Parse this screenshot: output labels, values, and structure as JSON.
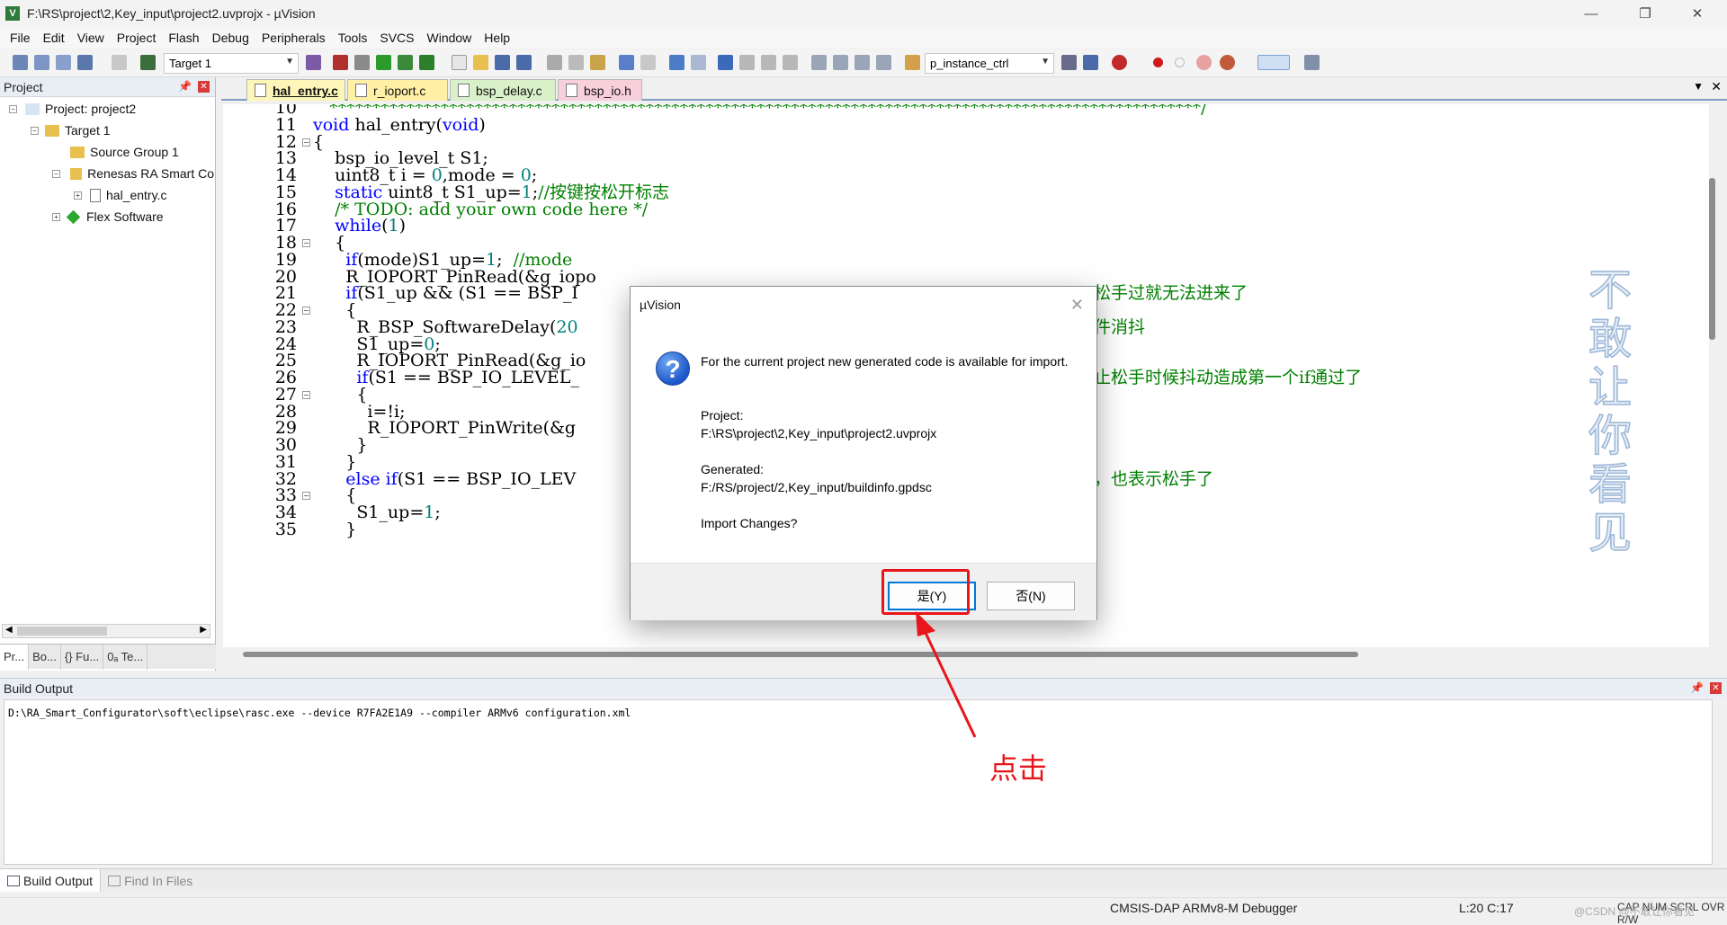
{
  "window": {
    "title": "F:\\RS\\project\\2,Key_input\\project2.uvprojx - µVision",
    "icon": "uvision-icon"
  },
  "menu": [
    "File",
    "Edit",
    "View",
    "Project",
    "Flash",
    "Debug",
    "Peripherals",
    "Tools",
    "SVCS",
    "Window",
    "Help"
  ],
  "toolbar": {
    "target": "Target 1",
    "find_value": "p_instance_ctrl"
  },
  "project_panel": {
    "title": "Project",
    "tree": [
      "Project: project2",
      "Target 1",
      "Source Group 1",
      "Renesas RA Smart Co",
      "hal_entry.c",
      "Flex Software"
    ],
    "tabs": [
      "Pr...",
      "Bo...",
      "{} Fu...",
      "0ₐ Te..."
    ]
  },
  "editor": {
    "tabs": [
      {
        "label": "hal_entry.c",
        "color": "#fdf6b8"
      },
      {
        "label": "r_ioport.c",
        "color": "#fff0a6"
      },
      {
        "label": "bsp_delay.c",
        "color": "#d9f0c9"
      },
      {
        "label": "bsp_io.h",
        "color": "#f8d0dc"
      }
    ],
    "lines": [
      {
        "n": "10",
        "t": "   ******************************************************************************************************/"
      },
      {
        "n": "11",
        "t": "void hal_entry(void)"
      },
      {
        "n": "12",
        "t": "{"
      },
      {
        "n": "13",
        "t": "    bsp_io_level_t S1;"
      },
      {
        "n": "14",
        "t": "    uint8_t i = 0,mode = 0;"
      },
      {
        "n": "15",
        "t": "    static uint8_t S1_up=1;//按键按松开标志"
      },
      {
        "n": "16",
        "t": "    /* TODO: add your own code here */"
      },
      {
        "n": "17",
        "t": "    while(1)"
      },
      {
        "n": "18",
        "t": "    {"
      },
      {
        "n": "19",
        "t": "      if(mode)S1_up=1;  //mode"
      },
      {
        "n": "20",
        "t": "      R_IOPORT_PinRead(&g_iopo"
      },
      {
        "n": "21",
        "t": "      if(S1_up && (S1 == BSP_I"
      },
      {
        "n": "22",
        "t": "      {"
      },
      {
        "n": "23",
        "t": "        R_BSP_SoftwareDelay(20"
      },
      {
        "n": "24",
        "t": "        S1_up=0;"
      },
      {
        "n": "25",
        "t": "        R_IOPORT_PinRead(&g_io"
      },
      {
        "n": "26",
        "t": "        if(S1 == BSP_IO_LEVEL_"
      },
      {
        "n": "27",
        "t": "        {"
      },
      {
        "n": "28",
        "t": "          i=!i;"
      },
      {
        "n": "29",
        "t": "          R_IOPORT_PinWrite(&g"
      },
      {
        "n": "30",
        "t": "        }"
      },
      {
        "n": "31",
        "t": "      }"
      },
      {
        "n": "32",
        "t": "      else if(S1 == BSP_IO_LEV"
      },
      {
        "n": "33",
        "t": "      {"
      },
      {
        "n": "34",
        "t": "        S1_up=1;"
      },
      {
        "n": "35",
        "t": "      }"
      }
    ],
    "right_comments": [
      {
        "line": "21",
        "t": "松手过就无法进来了"
      },
      {
        "line": "23",
        "t": "件消抖"
      },
      {
        "line": "26",
        "t": "止松手时候抖动造成第一个if通过了"
      },
      {
        "line": "32",
        "t": "，也表示松手了"
      }
    ],
    "watermark": "不敢让你看见"
  },
  "build_output": {
    "title": "Build Output",
    "text": "D:\\RA_Smart_Configurator\\soft\\eclipse\\rasc.exe --device R7FA2E1A9 --compiler ARMv6 configuration.xml",
    "tabs": [
      "Build Output",
      "Find In Files"
    ]
  },
  "status": {
    "debugger": "CMSIS-DAP ARMv8-M Debugger",
    "position": "L:20 C:17",
    "flags": "CAP NUM SCRL OVR R/W",
    "watermark": "@CSDN @不敢让你看见"
  },
  "dialog": {
    "title": "µVision",
    "message": "For the current project new generated code is available for import.",
    "project_label": "Project:",
    "project_path": "F:\\RS\\project\\2,Key_input\\project2.uvprojx",
    "generated_label": "Generated:",
    "generated_path": "F:/RS/project/2,Key_input/buildinfo.gpdsc",
    "question": "Import Changes?",
    "yes": "是(Y)",
    "no": "否(N)"
  },
  "annotation": {
    "text": "点击",
    "color": "#e8151b"
  }
}
